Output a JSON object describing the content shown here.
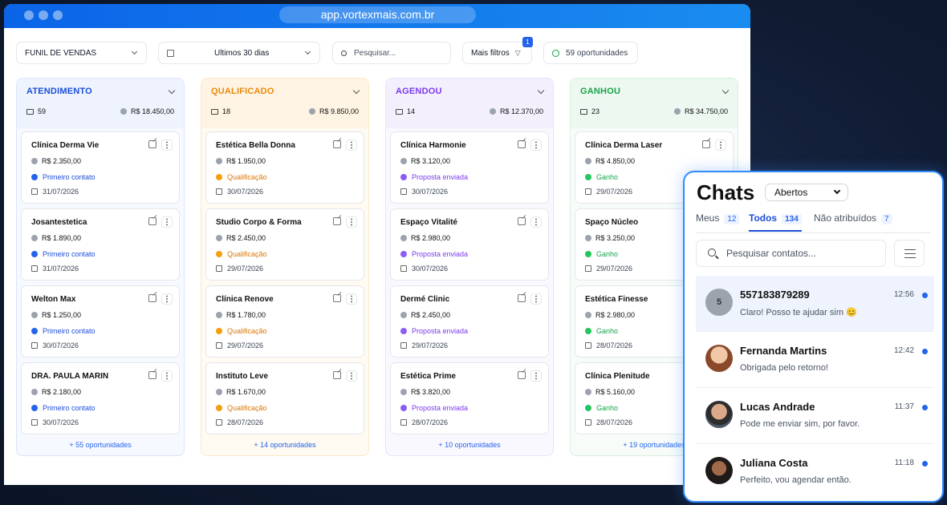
{
  "browser": {
    "url": "app.vortexmais.com.br"
  },
  "toolbar": {
    "pipeline": "FUNIL DE VENDAS",
    "period": "Ultimos 30 dias",
    "search_placeholder": "Pesquisar...",
    "filters": "Mais filtros",
    "filters_count": "1",
    "opportunities": "59 oportunidades"
  },
  "columns": [
    {
      "title": "ATENDIMENTO",
      "count": "59",
      "total": "R$ 18.450,00",
      "more": "+ 55 oportunidades",
      "cards": [
        {
          "name": "Clínica Derma Vie",
          "value": "R$ 2.350,00",
          "status": "Primeiro contato",
          "date": "31/07/2026"
        },
        {
          "name": "Josantestetica",
          "value": "R$ 1.890,00",
          "status": "Primeiro contato",
          "date": "31/07/2026"
        },
        {
          "name": "Welton Max",
          "value": "R$ 1.250,00",
          "status": "Primeiro contato",
          "date": "30/07/2026"
        },
        {
          "name": "DRA. PAULA MARIN",
          "value": "R$ 2.180,00",
          "status": "Primeiro contato",
          "date": "30/07/2026"
        }
      ]
    },
    {
      "title": "QUALIFICADO",
      "count": "18",
      "total": "R$ 9.850,00",
      "more": "+ 14 oportunidades",
      "cards": [
        {
          "name": "Estética Bella Donna",
          "value": "R$ 1.950,00",
          "status": "Qualificação",
          "date": "30/07/2026"
        },
        {
          "name": "Studio Corpo & Forma",
          "value": "R$ 2.450,00",
          "status": "Qualificação",
          "date": "29/07/2026"
        },
        {
          "name": "Clínica Renove",
          "value": "R$ 1.780,00",
          "status": "Qualificação",
          "date": "29/07/2026"
        },
        {
          "name": "Instituto Leve",
          "value": "R$ 1.670,00",
          "status": "Qualificação",
          "date": "28/07/2026"
        }
      ]
    },
    {
      "title": "AGENDOU",
      "count": "14",
      "total": "R$ 12.370,00",
      "more": "+ 10 oportunidades",
      "cards": [
        {
          "name": "Clínica Harmonie",
          "value": "R$ 3.120,00",
          "status": "Proposta enviada",
          "date": "30/07/2026"
        },
        {
          "name": "Espaço Vitalité",
          "value": "R$ 2.980,00",
          "status": "Proposta enviada",
          "date": "30/07/2026"
        },
        {
          "name": "Dermé Clinic",
          "value": "R$ 2.450,00",
          "status": "Proposta enviada",
          "date": "29/07/2026"
        },
        {
          "name": "Estética Prime",
          "value": "R$ 3.820,00",
          "status": "Proposta enviada",
          "date": "28/07/2026"
        }
      ]
    },
    {
      "title": "GANHOU",
      "count": "23",
      "total": "R$ 34.750,00",
      "more": "+ 19 oportunidades",
      "cards": [
        {
          "name": "Clínica Derma Laser",
          "value": "R$ 4.850,00",
          "status": "Ganho",
          "date": "29/07/2026"
        },
        {
          "name": "Spaço Núcleo",
          "value": "R$ 3.250,00",
          "status": "Ganho",
          "date": "29/07/2026"
        },
        {
          "name": "Estética Finesse",
          "value": "R$ 2.980,00",
          "status": "Ganho",
          "date": "28/07/2026"
        },
        {
          "name": "Clínica Plenitude",
          "value": "R$ 5.160,00",
          "status": "Ganho",
          "date": "28/07/2026"
        }
      ]
    }
  ],
  "colors": {
    "atendimento": "#1d4ed8",
    "qualificado": "#ea8a0c",
    "agendou": "#7c3aed",
    "ganhou": "#16a34a"
  },
  "chats": {
    "title": "Chats",
    "filter": "Abertos",
    "tabs": [
      {
        "label": "Meus",
        "count": "12"
      },
      {
        "label": "Todos",
        "count": "134"
      },
      {
        "label": "Não atribuídos",
        "count": "7"
      }
    ],
    "search_placeholder": "Pesquisar contatos...",
    "items": [
      {
        "name": "557183879289",
        "message": "Claro! Posso te ajudar sim 😊",
        "time": "12:56",
        "avatar": "5"
      },
      {
        "name": "Fernanda Martins",
        "message": "Obrigada pelo retorno!",
        "time": "12:42"
      },
      {
        "name": "Lucas Andrade",
        "message": "Pode me enviar sim, por favor.",
        "time": "11:37"
      },
      {
        "name": "Juliana Costa",
        "message": "Perfeito, vou agendar então.",
        "time": "11:18"
      }
    ]
  }
}
